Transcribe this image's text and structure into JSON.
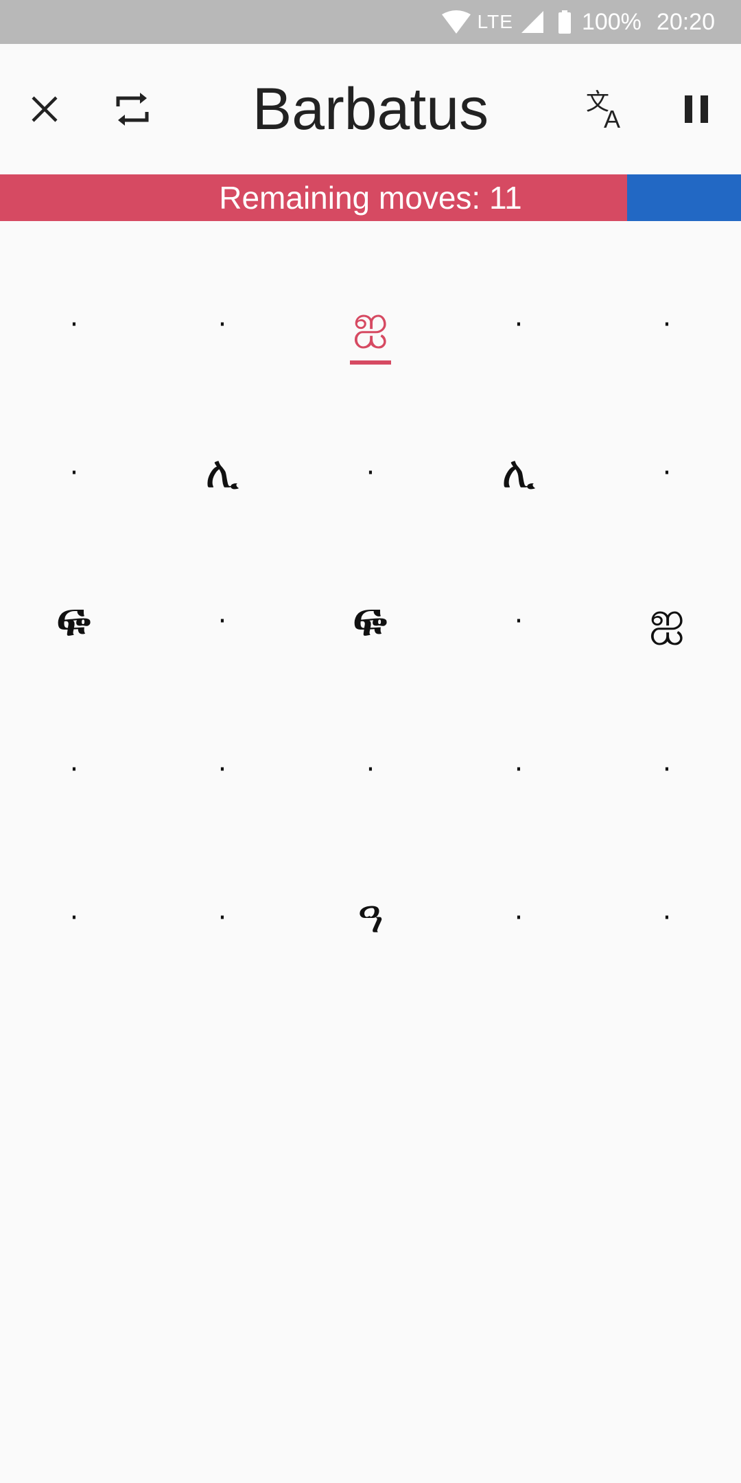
{
  "status_bar": {
    "network": "LTE",
    "battery": "100%",
    "time": "20:20",
    "icons": [
      "wifi-icon",
      "signal-icon",
      "battery-icon"
    ]
  },
  "app_bar": {
    "title": "Barbatus",
    "icons": [
      "close-icon",
      "repeat-icon",
      "translate-icon",
      "pause-icon"
    ]
  },
  "moves": {
    "label": "Remaining moves: 11",
    "remaining_fraction": 0.846,
    "fill_color": "#d64a62",
    "track_color": "#2268c4"
  },
  "board": {
    "rows": [
      [
        "·",
        "·",
        "ஐ",
        "·",
        "·"
      ],
      [
        "·",
        "ሊ",
        "·",
        "ሊ",
        "·"
      ],
      [
        "ᎋ",
        "·",
        "ᎋ",
        "·",
        "ஐ"
      ],
      [
        "·",
        "·",
        "·",
        "·",
        "·"
      ],
      [
        "·",
        "·",
        "ዓ",
        "·",
        "·"
      ]
    ],
    "selected": {
      "row": 0,
      "col": 2
    },
    "selected_color": "#d64a62"
  }
}
